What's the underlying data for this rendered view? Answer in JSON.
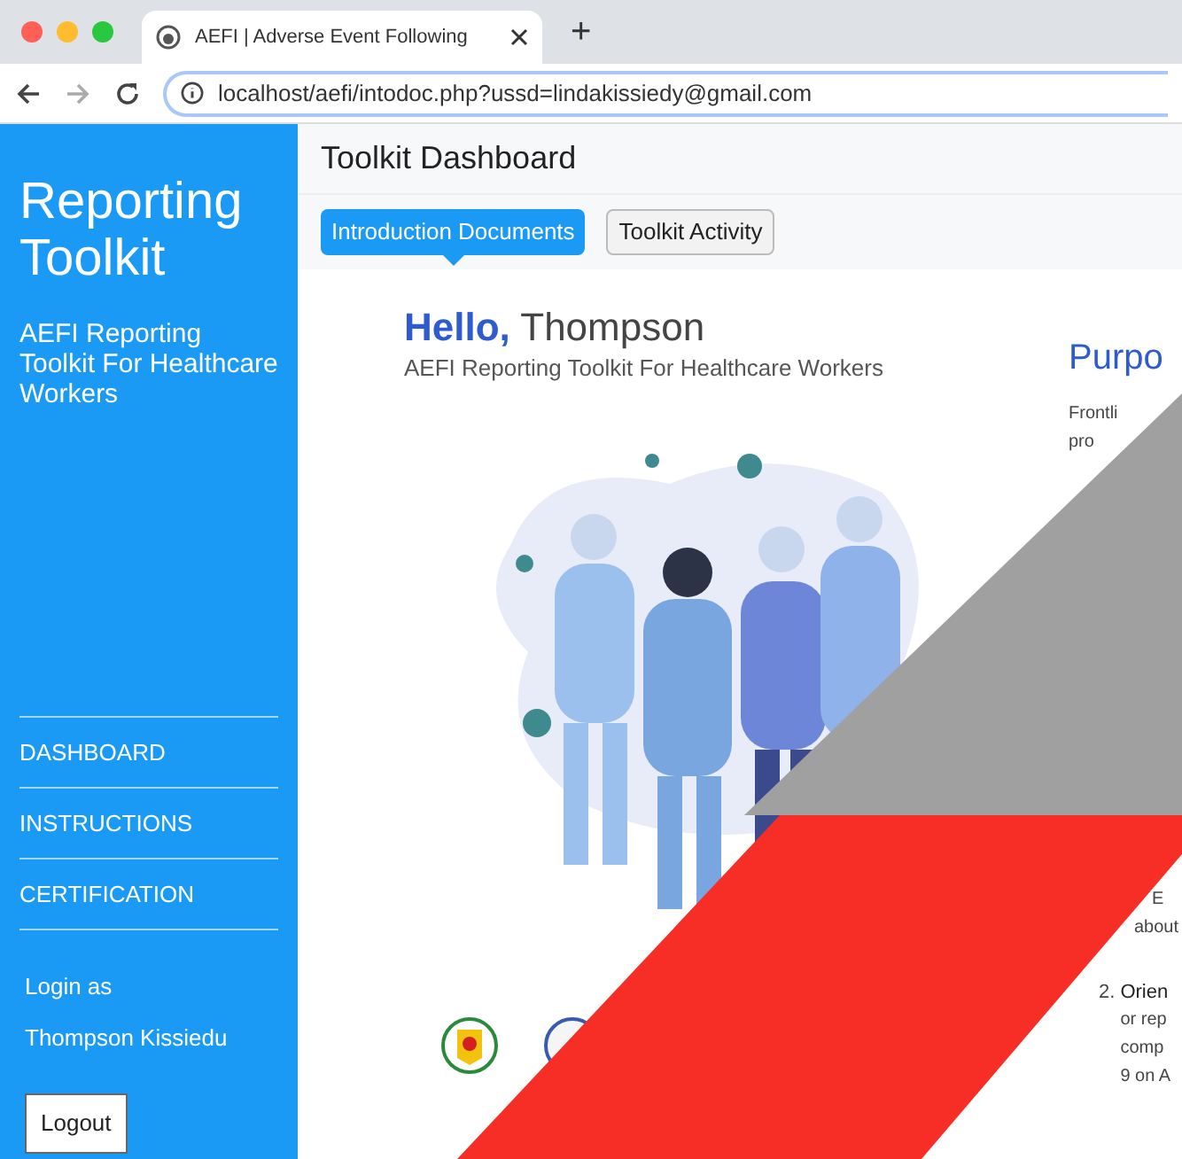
{
  "browser": {
    "tab_title": "AEFI | Adverse Event Following",
    "new_tab": "+",
    "address": "localhost/aefi/intodoc.php?ussd=lindakissiedy@gmail.com"
  },
  "sidebar": {
    "title": "Reporting Toolkit",
    "subtitle": "AEFI Reporting Toolkit For Healthcare Workers",
    "items": [
      {
        "label": "DASHBOARD"
      },
      {
        "label": "INSTRUCTIONS"
      },
      {
        "label": "CERTIFICATION"
      }
    ],
    "login_label": "Login as",
    "user": "Thompson Kissiedu",
    "logout": "Logout"
  },
  "header": {
    "title": "Toolkit Dashboard"
  },
  "tabs": [
    {
      "label": "Introduction Documents",
      "selected": true
    },
    {
      "label": "Toolkit Activity",
      "selected": false
    }
  ],
  "intro": {
    "greeting": "Hello,",
    "name": "Thompson",
    "subtitle": "AEFI Reporting Toolkit For Healthcare Workers"
  },
  "purpose": {
    "heading": "Purpo",
    "lines": [
      "Frontli",
      "pro"
    ],
    "lines_2": [
      "E",
      "about"
    ],
    "item_number": "2.",
    "item_title": "Orien",
    "item_lines": [
      "or rep",
      "comp",
      "9 on A"
    ]
  }
}
